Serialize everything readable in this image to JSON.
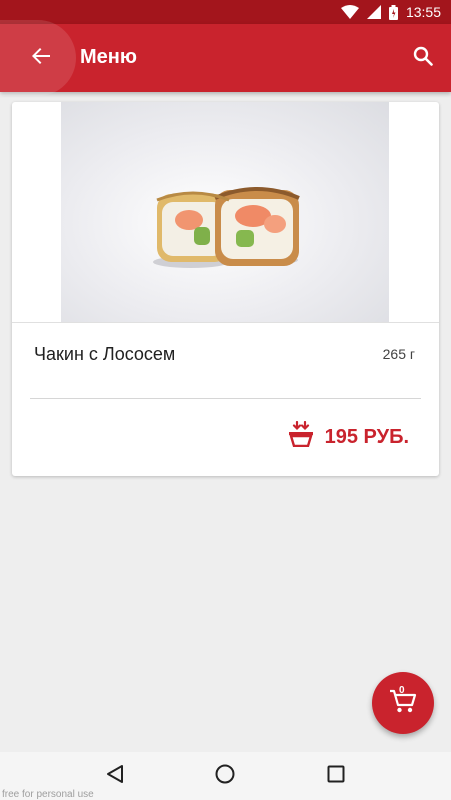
{
  "status_bar": {
    "time": "13:55",
    "icons": [
      "wifi-icon",
      "signal-icon",
      "battery-icon"
    ]
  },
  "app_bar": {
    "title": "Меню",
    "back_icon": "arrow-back-icon",
    "search_icon": "search-icon"
  },
  "product": {
    "name": "Чакин с Лососем",
    "weight": "265 г",
    "price": "195 РУБ.",
    "cart_icon": "add-to-basket-icon"
  },
  "cart_fab": {
    "count": "0",
    "icon": "cart-icon"
  },
  "nav_bar": {
    "icons": [
      "back-triangle-icon",
      "home-circle-icon",
      "recents-square-icon"
    ]
  },
  "watermark": "free for personal use",
  "colors": {
    "primary": "#c9232d",
    "status_bar": "#a3151c",
    "background": "#eeeeee"
  }
}
